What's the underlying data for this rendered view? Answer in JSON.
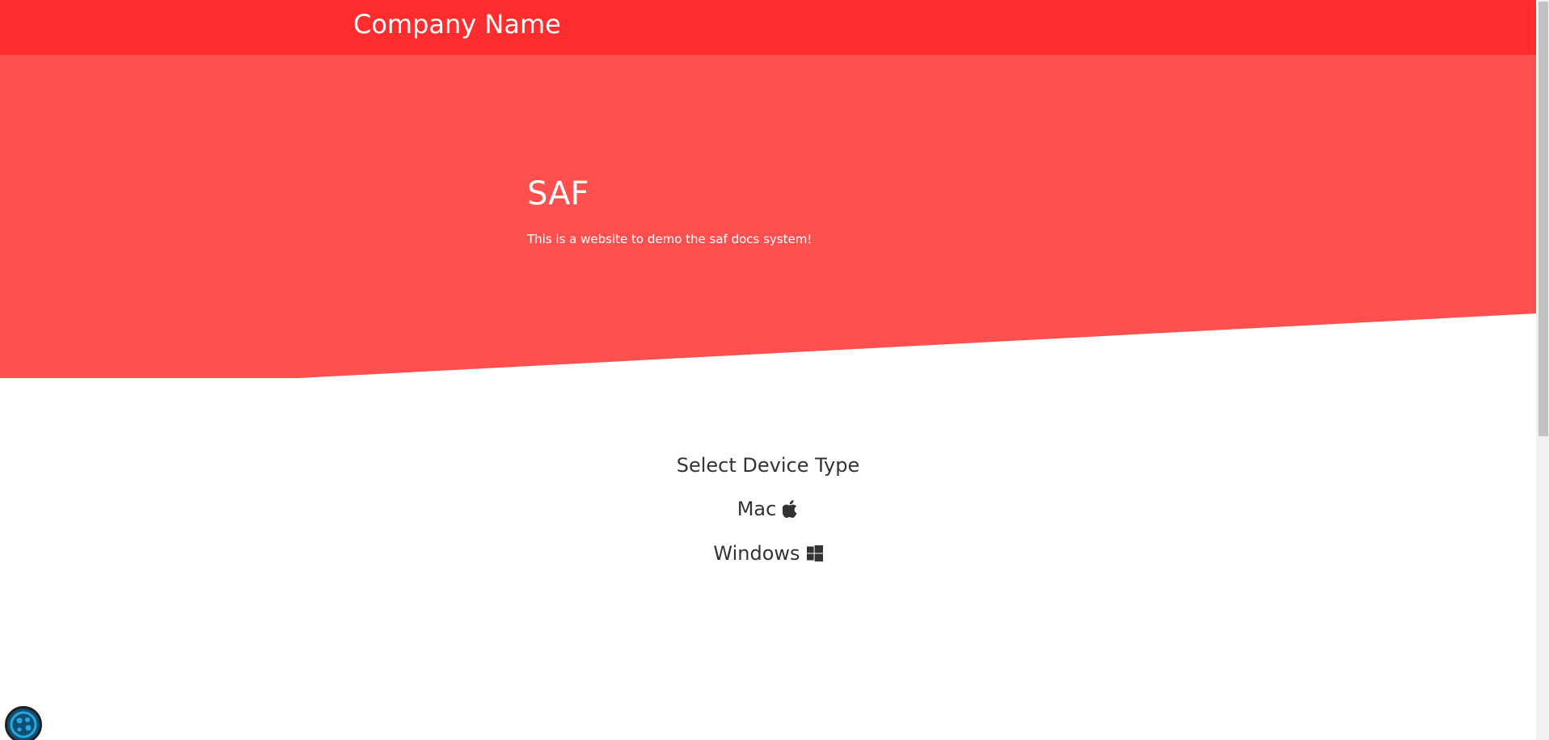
{
  "header": {
    "company_name": "Company Name"
  },
  "hero": {
    "title": "SAF",
    "subtitle": "This is a website to demo the saf docs system!"
  },
  "device_select": {
    "title": "Select Device Type",
    "options": [
      {
        "label": "Mac",
        "icon": "apple-icon"
      },
      {
        "label": "Windows",
        "icon": "windows-icon"
      }
    ]
  },
  "colors": {
    "header_bg": "#ff2d2d",
    "hero_bg": "#ff5050",
    "text_dark": "#333333",
    "text_light": "#ffffff"
  },
  "widget": {
    "icon": "cookie-settings-icon"
  }
}
